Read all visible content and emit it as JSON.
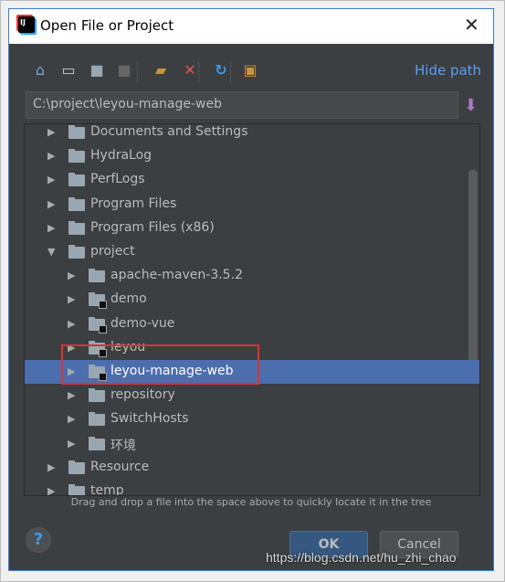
{
  "title": "Open File or Project",
  "toolbar": {
    "icons": [
      "home-icon",
      "desktop-icon",
      "project-folder-icon",
      "module-folder-icon",
      "new-folder-icon",
      "delete-icon",
      "refresh-icon",
      "show-hidden-icon"
    ],
    "hide_path": "Hide path"
  },
  "path": "C:\\project\\leyou-manage-web",
  "tree": [
    {
      "label": "Documents and Settings",
      "level": 0,
      "expanded": false
    },
    {
      "label": "HydraLog",
      "level": 0,
      "expanded": false
    },
    {
      "label": "PerfLogs",
      "level": 0,
      "expanded": false
    },
    {
      "label": "Program Files",
      "level": 0,
      "expanded": false
    },
    {
      "label": "Program Files (x86)",
      "level": 0,
      "expanded": false
    },
    {
      "label": "project",
      "level": 0,
      "expanded": true
    },
    {
      "label": "apache-maven-3.5.2",
      "level": 1,
      "expanded": false
    },
    {
      "label": "demo",
      "level": 1,
      "expanded": false,
      "module": true
    },
    {
      "label": "demo-vue",
      "level": 1,
      "expanded": false,
      "module": true
    },
    {
      "label": "leyou",
      "level": 1,
      "expanded": false,
      "module": true
    },
    {
      "label": "leyou-manage-web",
      "level": 1,
      "expanded": false,
      "module": true,
      "selected": true
    },
    {
      "label": "repository",
      "level": 1,
      "expanded": false
    },
    {
      "label": "SwitchHosts",
      "level": 1,
      "expanded": false
    },
    {
      "label": "环境",
      "level": 1,
      "expanded": false
    },
    {
      "label": "Resource",
      "level": 0,
      "expanded": false
    },
    {
      "label": "temp",
      "level": 0,
      "expanded": false
    }
  ],
  "hint": "Drag and drop a file into the space above to quickly locate it in the tree",
  "buttons": {
    "help": "?",
    "ok": "OK",
    "cancel": "Cancel"
  },
  "watermark": "https://blog.csdn.net/hu_zhi_chao",
  "colors": {
    "selection": "#4b6eaf",
    "accent": "#589df6",
    "highlight_box": "#e03030"
  }
}
